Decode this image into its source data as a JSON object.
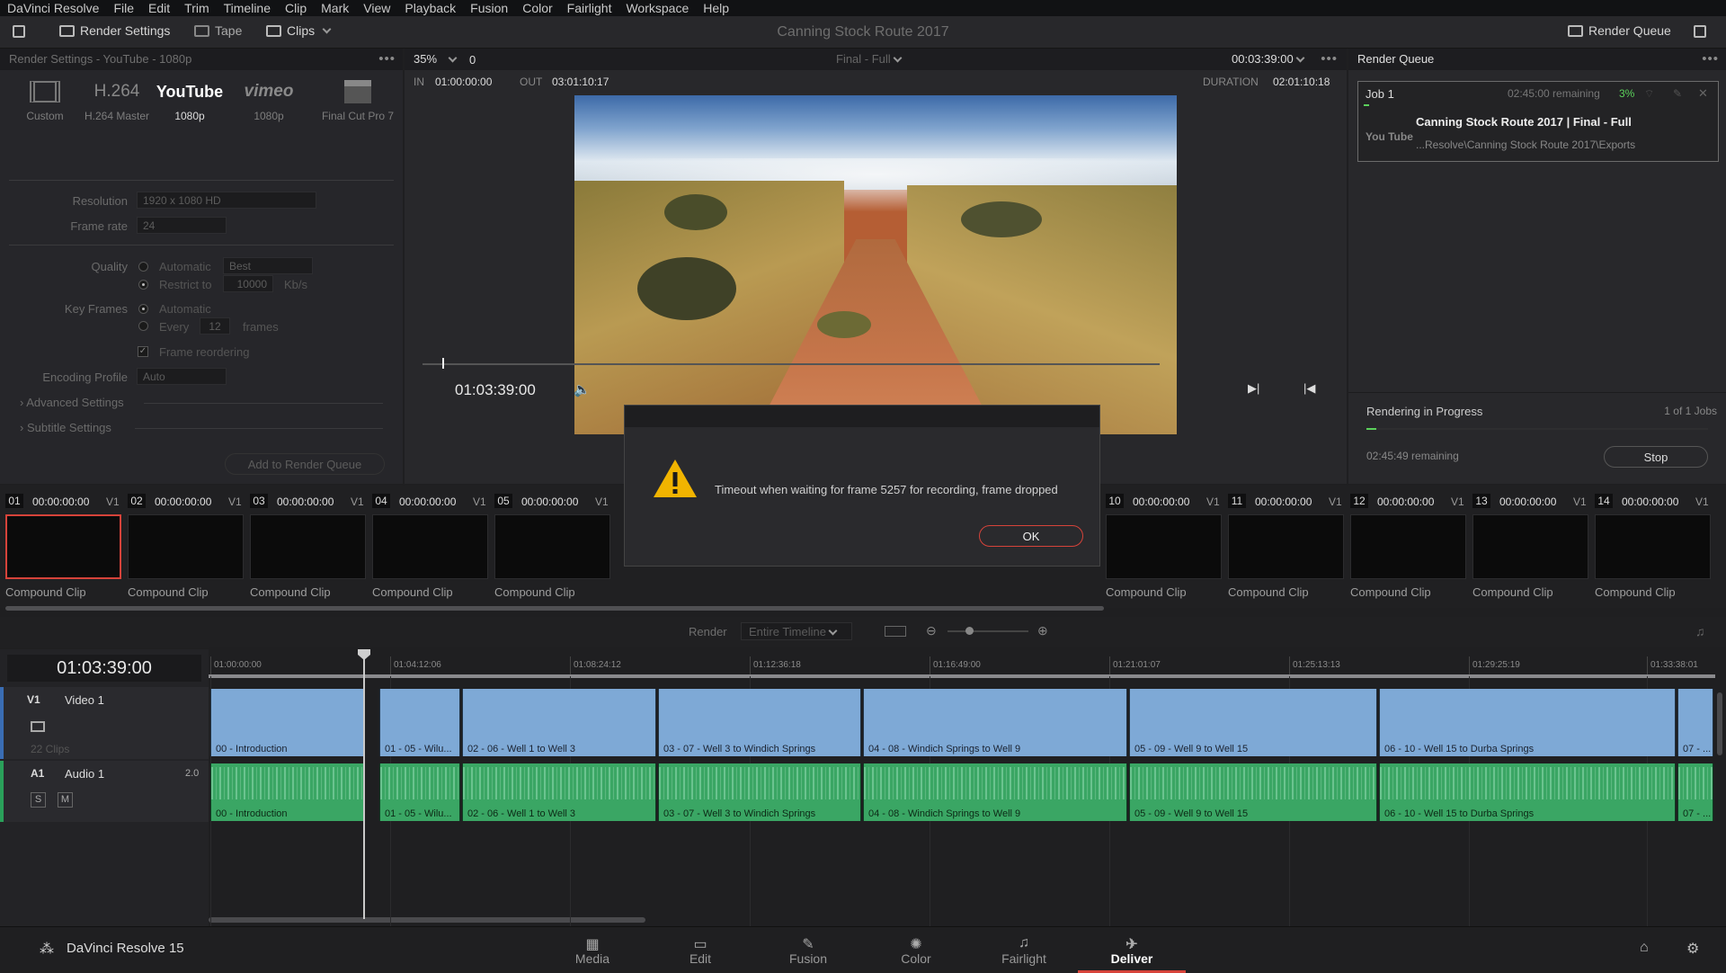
{
  "menu": [
    "DaVinci Resolve",
    "File",
    "Edit",
    "Trim",
    "Timeline",
    "Clip",
    "Mark",
    "View",
    "Playback",
    "Fusion",
    "Color",
    "Fairlight",
    "Workspace",
    "Help"
  ],
  "toolbar": {
    "render_settings": "Render Settings",
    "tape": "Tape",
    "clips": "Clips",
    "project_title": "Canning Stock Route 2017",
    "render_queue": "Render Queue"
  },
  "render_settings": {
    "header": "Render Settings - YouTube - 1080p",
    "presets": [
      {
        "icon": "film-strip-icon",
        "title": "",
        "label": "Custom"
      },
      {
        "icon": "h264-icon",
        "title": "H.264",
        "label": "H.264 Master"
      },
      {
        "icon": "youtube-icon",
        "title": "YouTube",
        "label": "1080p"
      },
      {
        "icon": "vimeo-icon",
        "title": "vimeo",
        "label": "1080p"
      },
      {
        "icon": "clapper-icon",
        "title": "",
        "label": "Final Cut Pro 7"
      }
    ],
    "resolution_label": "Resolution",
    "resolution": "1920 x 1080 HD",
    "framerate_label": "Frame rate",
    "framerate": "24",
    "quality_label": "Quality",
    "quality_auto": "Automatic",
    "quality_best": "Best",
    "restrict_to": "Restrict to",
    "restrict_value": "10000",
    "kbs": "Kb/s",
    "keyframes_label": "Key Frames",
    "kf_auto": "Automatic",
    "kf_every": "Every",
    "kf_value": "12",
    "kf_frames": "frames",
    "frame_reordering": "Frame reordering",
    "encoding_label": "Encoding Profile",
    "encoding": "Auto",
    "advanced": "Advanced Settings",
    "subtitle": "Subtitle Settings",
    "add_queue": "Add to Render Queue"
  },
  "viewer": {
    "zoom": "35%",
    "zoom_field": "0",
    "title": "Final - Full",
    "timecode_top": "00:03:39:00",
    "in_label": "IN",
    "in_tc": "01:00:00:00",
    "out_label": "OUT",
    "out_tc": "03:01:10:17",
    "duration_label": "DURATION",
    "duration_tc": "02:01:10:18",
    "current_tc": "01:03:39:00"
  },
  "queue": {
    "header": "Render Queue",
    "job": "Job 1",
    "remaining": "02:45:00 remaining",
    "percent": "3%",
    "job_title": "Canning Stock Route 2017 | Final - Full",
    "job_path": "...Resolve\\Canning Stock Route 2017\\Exports",
    "job_icon": "You Tube",
    "progress_title": "Rendering in Progress",
    "jobs_count": "1 of 1 Jobs",
    "bottom_remaining": "02:45:49 remaining",
    "stop": "Stop",
    "progress": 0.03
  },
  "dialog": {
    "message": "Timeout when waiting for frame 5257 for recording, frame dropped",
    "ok": "OK"
  },
  "thumbs": [
    {
      "num": "01",
      "tc": "00:00:00:00",
      "v": "V1"
    },
    {
      "num": "02",
      "tc": "00:00:00:00",
      "v": "V1"
    },
    {
      "num": "03",
      "tc": "00:00:00:00",
      "v": "V1"
    },
    {
      "num": "04",
      "tc": "00:00:00:00",
      "v": "V1"
    },
    {
      "num": "05",
      "tc": "00:00:00:00",
      "v": "V1"
    },
    {
      "num": "10",
      "tc": "00:00:00:00",
      "v": "V1"
    },
    {
      "num": "11",
      "tc": "00:00:00:00",
      "v": "V1"
    },
    {
      "num": "12",
      "tc": "00:00:00:00",
      "v": "V1"
    },
    {
      "num": "13",
      "tc": "00:00:00:00",
      "v": "V1"
    },
    {
      "num": "14",
      "tc": "00:00:00:00",
      "v": "V1"
    }
  ],
  "thumb_label": "Compound Clip",
  "timeline": {
    "render_label": "Render",
    "render_value": "Entire Timeline",
    "timecode": "01:03:39:00",
    "ruler": [
      "01:00:00:00",
      "01:04:12:06",
      "01:08:24:12",
      "01:12:36:18",
      "01:16:49:00",
      "01:21:01:07",
      "01:25:13:13",
      "01:29:25:19",
      "01:33:38:01"
    ],
    "v1_tag": "V1",
    "v1_name": "Video 1",
    "v1_clips": "22 Clips",
    "a1_tag": "A1",
    "a1_name": "Audio 1",
    "a1_ch": "2.0",
    "solo": "S",
    "mute": "M",
    "clips": [
      "00 - Introduction",
      "01 - 05 - Wilu...",
      "02 - 06 - Well 1 to Well 3",
      "03 - 07 - Well 3 to Windich Springs",
      "04 - 08 - Windich Springs to Well 9",
      "05 - 09 - Well 9 to Well 15",
      "06 - 10 - Well 15 to Durba Springs",
      "07 - ..."
    ]
  },
  "pages": {
    "app": "DaVinci Resolve 15",
    "tabs": [
      "Media",
      "Edit",
      "Fusion",
      "Color",
      "Fairlight",
      "Deliver"
    ]
  }
}
